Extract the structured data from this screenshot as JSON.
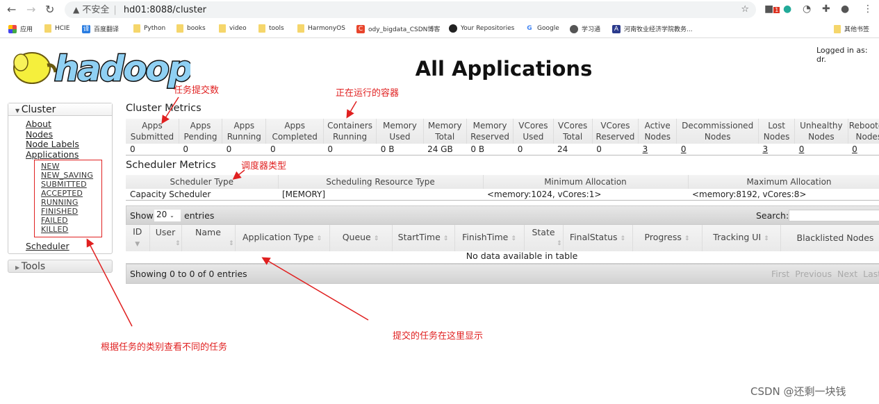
{
  "browser": {
    "security": "不安全",
    "url": "hd01:8088/cluster",
    "ext_badge": "1",
    "bookmarks": [
      "应用",
      "HCIE",
      "百度翻译",
      "Python",
      "books",
      "video",
      "tools",
      "HarmonyOS",
      "ody_bigdata_CSDN博客",
      "Your Repositories",
      "Google",
      "学习通",
      "河南牧业经济学院教务...",
      "其他书签"
    ]
  },
  "header": {
    "logo": "hadoop",
    "title": "All Applications",
    "logged_in": "Logged in as: dr."
  },
  "sidebar": {
    "cluster": "Cluster",
    "links": [
      "About",
      "Nodes",
      "Node Labels",
      "Applications"
    ],
    "states": [
      "NEW",
      "NEW_SAVING",
      "SUBMITTED",
      "ACCEPTED",
      "RUNNING",
      "FINISHED",
      "FAILED",
      "KILLED"
    ],
    "scheduler": "Scheduler",
    "tools": "Tools"
  },
  "cluster_metrics": {
    "title": "Cluster Metrics",
    "headers": [
      [
        "Apps",
        "Submitted"
      ],
      [
        "Apps",
        "Pending"
      ],
      [
        "Apps",
        "Running"
      ],
      [
        "Apps",
        "Completed"
      ],
      [
        "Containers",
        "Running"
      ],
      [
        "Memory",
        "Used"
      ],
      [
        "Memory",
        "Total"
      ],
      [
        "Memory",
        "Reserved"
      ],
      [
        "VCores",
        "Used"
      ],
      [
        "VCores",
        "Total"
      ],
      [
        "VCores",
        "Reserved"
      ],
      [
        "Active",
        "Nodes"
      ],
      [
        "Decommissioned",
        "Nodes"
      ],
      [
        "Lost",
        "Nodes"
      ],
      [
        "Unhealthy",
        "Nodes"
      ],
      [
        "Rebooted",
        "Nodes"
      ]
    ],
    "values": [
      "0",
      "0",
      "0",
      "0",
      "0",
      "0 B",
      "24 GB",
      "0 B",
      "0",
      "24",
      "0",
      "3",
      "0",
      "3",
      "0",
      "0"
    ]
  },
  "scheduler_metrics": {
    "title": "Scheduler Metrics",
    "headers": [
      "Scheduler Type",
      "Scheduling Resource Type",
      "Minimum Allocation",
      "Maximum Allocation"
    ],
    "values": [
      "Capacity Scheduler",
      "[MEMORY]",
      "<memory:1024, vCores:1>",
      "<memory:8192, vCores:8>"
    ]
  },
  "apps_table": {
    "show": "Show",
    "page_size": "20",
    "entries": "entries",
    "search": "Search:",
    "columns": [
      "ID",
      "User",
      "Name",
      "Application Type",
      "Queue",
      "StartTime",
      "FinishTime",
      "State",
      "FinalStatus",
      "Progress",
      "Tracking UI",
      "Blacklisted Nodes"
    ],
    "empty": "No data available in table",
    "info": "Showing 0 to 0 of 0 entries",
    "pager": [
      "First",
      "Previous",
      "Next",
      "Last"
    ]
  },
  "annotations": {
    "submitted": "任务提交数",
    "containers": "正在运行的容器",
    "scheduler": "调度器类型",
    "states": "根据任务的类别查看不同的任务",
    "table": "提交的任务在这里显示"
  },
  "watermark": "CSDN @还剩一块钱"
}
